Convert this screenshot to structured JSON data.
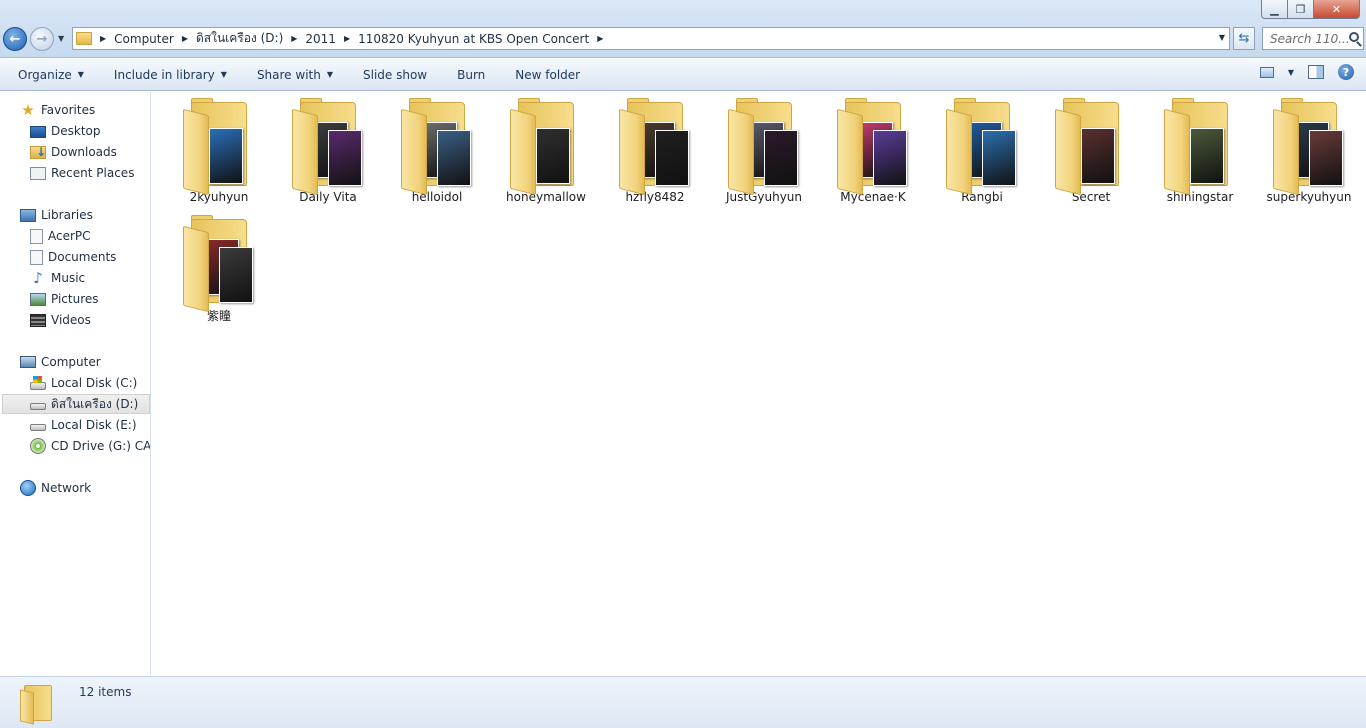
{
  "window": {
    "controls": {
      "minimize": "▁",
      "maximize": "❐",
      "close": "✕"
    }
  },
  "address": {
    "crumbs": [
      "Computer",
      "ดิสในเครือง (D:)",
      "2011",
      "110820 Kyuhyun at KBS Open Concert"
    ]
  },
  "search": {
    "placeholder": "Search 110..."
  },
  "toolbar": {
    "organize": "Organize",
    "include_in_library": "Include in library",
    "share_with": "Share with",
    "slide_show": "Slide show",
    "burn": "Burn",
    "new_folder": "New folder",
    "help": "?"
  },
  "navpane": {
    "favorites": "Favorites",
    "desktop": "Desktop",
    "downloads": "Downloads",
    "recent_places": "Recent Places",
    "libraries": "Libraries",
    "acerpc": "AcerPC",
    "documents": "Documents",
    "music": "Music",
    "pictures": "Pictures",
    "videos": "Videos",
    "computer": "Computer",
    "drive_c": "Local Disk (C:)",
    "drive_d": "ดิสในเครือง (D:)",
    "drive_e": "Local Disk (E:)",
    "drive_g": "CD Drive (G:) CAT CD",
    "network": "Network"
  },
  "folders": [
    {
      "name": "2kyuhyun",
      "photo1": "#2a6fb8",
      "photo2": "#1b2b48"
    },
    {
      "name": "Daily Vita",
      "photo1": "#3d3d3d",
      "photo2": "#5a2a6e"
    },
    {
      "name": "helloidol",
      "photo1": "#6d6d6d",
      "photo2": "#3b5f85"
    },
    {
      "name": "honeymallow",
      "photo1": "#2f2f2f",
      "photo2": "#1e1e1e"
    },
    {
      "name": "hzfly8482",
      "photo1": "#4a3a2a",
      "photo2": "#1f1f1f"
    },
    {
      "name": "JustGyuhyun",
      "photo1": "#5a5a6a",
      "photo2": "#2a1a2a"
    },
    {
      "name": "Mycenae·K",
      "photo1": "#c23b6b",
      "photo2": "#5a3d9a"
    },
    {
      "name": "Rangbi",
      "photo1": "#1f5c9e",
      "photo2": "#2c6fb0"
    },
    {
      "name": "Secret",
      "photo1": "#5a2f2f",
      "photo2": "#3a3a3a"
    },
    {
      "name": "shiningstar",
      "photo1": "#4a5a3a",
      "photo2": "#7a6a4a"
    },
    {
      "name": "superkyuhyun",
      "photo1": "#2a3a4a",
      "photo2": "#6a3a3a"
    },
    {
      "name": "紫瞳",
      "photo1": "#8a2a2a",
      "photo2": "#3a3a3a"
    }
  ],
  "status": {
    "item_count": "12 items"
  }
}
